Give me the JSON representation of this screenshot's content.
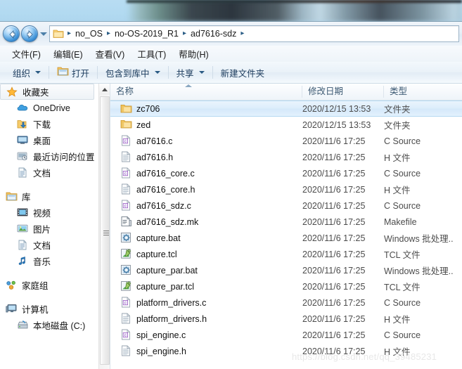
{
  "window": {
    "breadcrumb": {
      "segments": [
        "no_OS",
        "no-OS-2019_R1",
        "ad7616-sdz"
      ],
      "separator": "▸"
    }
  },
  "menubar": {
    "items": [
      {
        "label": "文件(F)"
      },
      {
        "label": "编辑(E)"
      },
      {
        "label": "查看(V)"
      },
      {
        "label": "工具(T)"
      },
      {
        "label": "帮助(H)"
      }
    ]
  },
  "commandbar": {
    "organize": "组织",
    "open": "打开",
    "include_in_library": "包含到库中",
    "share": "共享",
    "new_folder": "新建文件夹"
  },
  "sidebar": {
    "groups": [
      {
        "header": {
          "label": "收藏夹",
          "icon": "star-icon",
          "selected": true
        },
        "items": [
          {
            "label": "OneDrive",
            "icon": "onedrive-icon"
          },
          {
            "label": "下载",
            "icon": "downloads-icon"
          },
          {
            "label": "桌面",
            "icon": "desktop-icon"
          },
          {
            "label": "最近访问的位置",
            "icon": "recent-places-icon"
          },
          {
            "label": "文档",
            "icon": "documents-icon"
          }
        ]
      },
      {
        "header": {
          "label": "库",
          "icon": "library-icon",
          "selected": false
        },
        "items": [
          {
            "label": "视频",
            "icon": "videos-icon"
          },
          {
            "label": "图片",
            "icon": "pictures-icon"
          },
          {
            "label": "文档",
            "icon": "documents-icon"
          },
          {
            "label": "音乐",
            "icon": "music-icon"
          }
        ]
      },
      {
        "header": {
          "label": "家庭组",
          "icon": "homegroup-icon",
          "selected": false
        },
        "items": []
      },
      {
        "header": {
          "label": "计算机",
          "icon": "computer-icon",
          "selected": false
        },
        "items": [
          {
            "label": "本地磁盘 (C:)",
            "icon": "local-disk-icon"
          }
        ]
      }
    ]
  },
  "filelist": {
    "columns": [
      {
        "key": "name",
        "label": "名称",
        "sorted": true
      },
      {
        "key": "date",
        "label": "修改日期",
        "sorted": false
      },
      {
        "key": "type",
        "label": "类型",
        "sorted": false
      }
    ],
    "rows": [
      {
        "name": "zc706",
        "date": "2020/12/15 13:53",
        "type": "文件夹",
        "icon": "folder-icon",
        "selected": true
      },
      {
        "name": "zed",
        "date": "2020/12/15 13:53",
        "type": "文件夹",
        "icon": "folder-icon",
        "selected": false
      },
      {
        "name": "ad7616.c",
        "date": "2020/11/6 17:25",
        "type": "C Source",
        "icon": "c-source-icon",
        "selected": false
      },
      {
        "name": "ad7616.h",
        "date": "2020/11/6 17:25",
        "type": "H 文件",
        "icon": "h-file-icon",
        "selected": false
      },
      {
        "name": "ad7616_core.c",
        "date": "2020/11/6 17:25",
        "type": "C Source",
        "icon": "c-source-icon",
        "selected": false
      },
      {
        "name": "ad7616_core.h",
        "date": "2020/11/6 17:25",
        "type": "H 文件",
        "icon": "h-file-icon",
        "selected": false
      },
      {
        "name": "ad7616_sdz.c",
        "date": "2020/11/6 17:25",
        "type": "C Source",
        "icon": "c-source-icon",
        "selected": false
      },
      {
        "name": "ad7616_sdz.mk",
        "date": "2020/11/6 17:25",
        "type": "Makefile",
        "icon": "makefile-icon",
        "selected": false
      },
      {
        "name": "capture.bat",
        "date": "2020/11/6 17:25",
        "type": "Windows 批处理..",
        "icon": "bat-icon",
        "selected": false
      },
      {
        "name": "capture.tcl",
        "date": "2020/11/6 17:25",
        "type": "TCL 文件",
        "icon": "tcl-icon",
        "selected": false
      },
      {
        "name": "capture_par.bat",
        "date": "2020/11/6 17:25",
        "type": "Windows 批处理..",
        "icon": "bat-icon",
        "selected": false
      },
      {
        "name": "capture_par.tcl",
        "date": "2020/11/6 17:25",
        "type": "TCL 文件",
        "icon": "tcl-icon",
        "selected": false
      },
      {
        "name": "platform_drivers.c",
        "date": "2020/11/6 17:25",
        "type": "C Source",
        "icon": "c-source-icon",
        "selected": false
      },
      {
        "name": "platform_drivers.h",
        "date": "2020/11/6 17:25",
        "type": "H 文件",
        "icon": "h-file-icon",
        "selected": false
      },
      {
        "name": "spi_engine.c",
        "date": "2020/11/6 17:25",
        "type": "C Source",
        "icon": "c-source-icon",
        "selected": false
      },
      {
        "name": "spi_engine.h",
        "date": "2020/11/6 17:25",
        "type": "H 文件",
        "icon": "h-file-icon",
        "selected": false
      }
    ]
  },
  "watermark": {
    "text": "https://blog.csdn.net/qq_39485231"
  },
  "colors": {
    "selection_blue": "#d4e8fa",
    "aero_blue": "#b2daf1",
    "header_text": "#3d5a73"
  }
}
